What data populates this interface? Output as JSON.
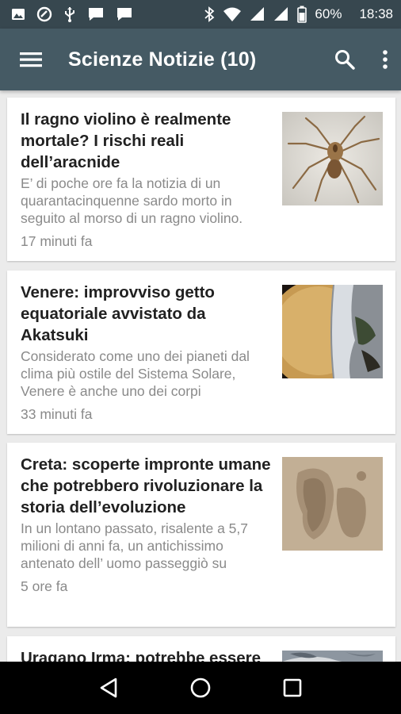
{
  "status_bar": {
    "battery": "60%",
    "time": "18:38",
    "left_icons": [
      "photo-icon",
      "blocked-icon",
      "usb-icon",
      "message-icon",
      "message-icon"
    ],
    "right_icons": [
      "bluetooth-icon",
      "wifi-icon",
      "signal-icon",
      "signal-icon",
      "battery-icon"
    ]
  },
  "app_bar": {
    "title": "Scienze Notizie (10)",
    "menu_icon": "hamburger-menu-icon",
    "search_icon": "search-icon",
    "overflow_icon": "more-vert-icon",
    "color": "#455a64"
  },
  "articles": [
    {
      "title": "Il ragno violino è realmente mortale? I rischi reali dell’aracnide",
      "snippet": "E’ di poche ore fa la notizia di un quarantacinquenne sardo morto in seguito al morso di un ragno violino.",
      "time": "17 minuti fa",
      "image": "brown-recluse-spider"
    },
    {
      "title": "Venere: improvviso getto equatoriale avvistato da Akatsuki",
      "snippet": "Considerato come uno dei pianeti dal clima più ostile del Sistema Solare, Venere è anche uno dei corpi",
      "time": "33 minuti fa",
      "image": "venus-planet"
    },
    {
      "title": "Creta: scoperte impronte umane che potrebbero rivoluzionare la storia dell’evoluzione",
      "snippet": "In un lontano passato, risalente a 5,7 milioni di anni fa, un antichissimo antenato dell’ uomo passeggiò su",
      "time": "5 ore fa",
      "image": "fossil-footprint"
    },
    {
      "title": "Uragano Irma: potrebbe essere",
      "snippet": "",
      "time": "",
      "image": "hurricane-satellite"
    }
  ],
  "nav_bar": {
    "back_icon": "back-icon",
    "home_icon": "home-icon",
    "recents_icon": "recents-icon"
  }
}
